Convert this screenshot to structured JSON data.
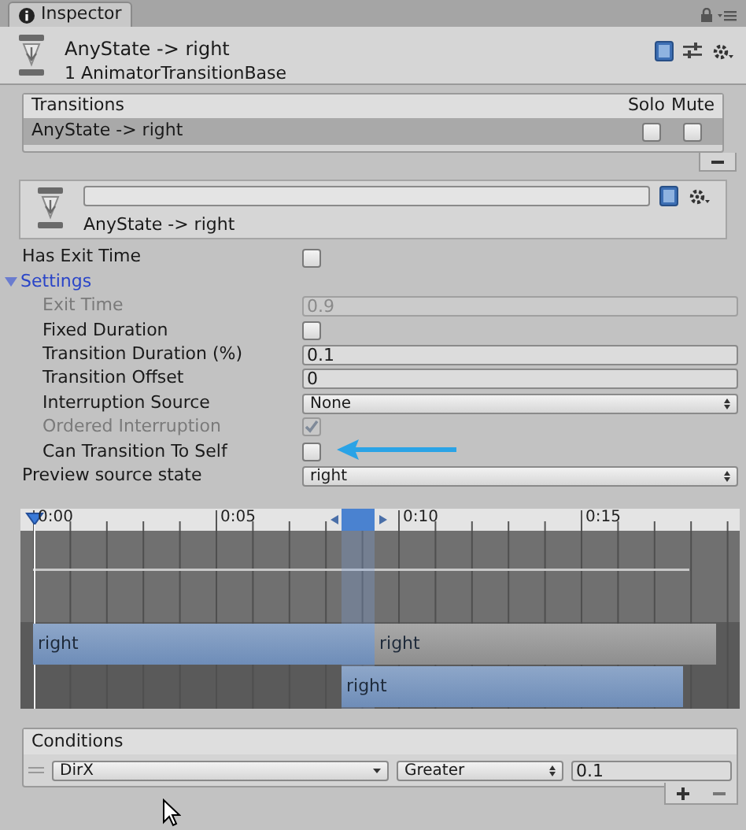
{
  "tab": {
    "label": "Inspector",
    "selected": true
  },
  "header": {
    "title": "AnyState -> right",
    "subtitle": "1 AnimatorTransitionBase"
  },
  "transitions": {
    "title": "Transitions",
    "columns": [
      "Solo",
      "Mute"
    ],
    "rows": [
      {
        "name": "AnyState -> right",
        "selected": true,
        "solo": false,
        "mute": false
      }
    ]
  },
  "transition": {
    "label": "AnyState -> right"
  },
  "properties": [
    {
      "kind": "checkbox",
      "label": "Has Exit Time",
      "checked": false,
      "disabled": false
    },
    {
      "kind": "foldout",
      "label": "Settings",
      "expanded": true,
      "children": [
        {
          "kind": "field",
          "label": "Exit Time",
          "value": "0.9",
          "disabled": true
        },
        {
          "kind": "checkbox",
          "label": "Fixed Duration",
          "checked": false,
          "disabled": false
        },
        {
          "kind": "field",
          "label": "Transition Duration (%)",
          "value": "0.1",
          "disabled": false
        },
        {
          "kind": "field",
          "label": "Transition Offset",
          "value": "0",
          "disabled": false
        },
        {
          "kind": "dropdown",
          "label": "Interruption Source",
          "value": "None",
          "disabled": false
        },
        {
          "kind": "checkbox",
          "label": "Ordered Interruption",
          "checked": true,
          "disabled": true
        },
        {
          "kind": "checkbox",
          "label": "Can Transition To Self",
          "checked": false,
          "disabled": false
        }
      ]
    },
    {
      "kind": "dropdown",
      "label": "Preview source state",
      "value": "right",
      "disabled": false
    }
  ],
  "timeline": {
    "ticks": [
      "0:00",
      "0:05",
      "0:10",
      "0:15"
    ],
    "clips": [
      {
        "label": "right"
      },
      {
        "label": "right"
      },
      {
        "label": "right"
      }
    ]
  },
  "conditions": {
    "title": "Conditions",
    "rows": [
      {
        "parameter": "DirX",
        "mode": "Greater",
        "value": "0.1"
      }
    ]
  }
}
